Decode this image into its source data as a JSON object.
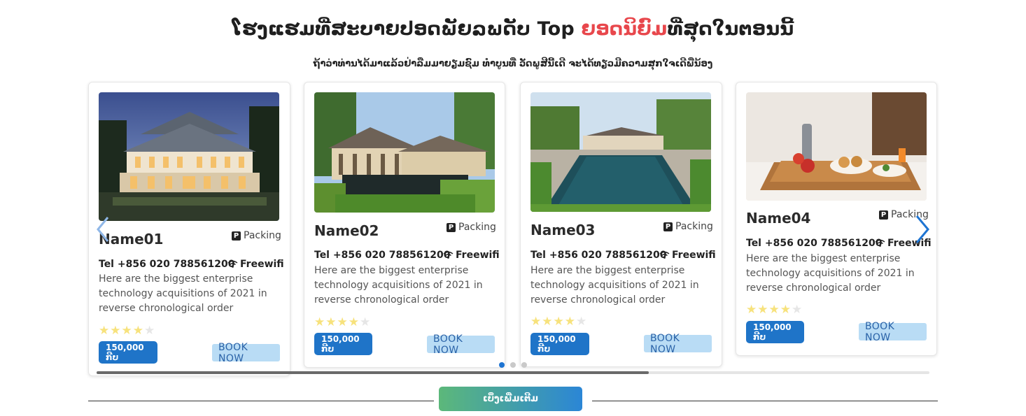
{
  "header": {
    "title_part1": "ໂຮງແຮມທີ່ສະບາຍປອດພັຍລພດັບ Top ",
    "title_accent": "ຍອດນິຍົມ",
    "title_part2": "ທີ່ສຸດໃນຕອນນີ້",
    "subtitle": "ຖ້າວ່າທ່ານໄດ້ມາແລ້ວຢ່າລືມມາຍຽມຊົມ ທຳບູນທີ່ ວັດພູສີນີ້ເດີ ຈະໄດ້ທຽວມີຄວາມສຸກໃຈເດີພີ່ນ້ອງ",
    "accent_color": "#e8474c"
  },
  "cards": [
    {
      "name": "Name01",
      "packing_label": "Packing",
      "tel": "Tel +856 020 788561200",
      "wifi_label": "Freewifi",
      "description": "Here are the biggest enterprise technology acquisitions of 2021 in reverse chronological order",
      "rating": 4,
      "rating_max": 5,
      "price": "150,000 ກີບ",
      "book_label": "BOOK NOW",
      "image": "hotel-night-facade"
    },
    {
      "name": "Name02",
      "packing_label": "Packing",
      "tel": "Tel +856 020 788561200",
      "wifi_label": "Freewifi",
      "description": "Here are the biggest enterprise technology acquisitions of 2021 in reverse chronological order",
      "rating": 4,
      "rating_max": 5,
      "price": "150,000 ກີບ",
      "book_label": "BOOK NOW",
      "image": "hotel-garden-pool"
    },
    {
      "name": "Name03",
      "packing_label": "Packing",
      "tel": "Tel +856 020 788561200",
      "wifi_label": "Freewifi",
      "description": "Here are the biggest enterprise technology acquisitions of 2021 in reverse chronological order",
      "rating": 4,
      "rating_max": 5,
      "price": "150,000 ກີບ",
      "book_label": "BOOK NOW",
      "image": "hotel-long-pool"
    },
    {
      "name": "Name04",
      "packing_label": "Packing",
      "tel": "Tel +856 020 788561200",
      "wifi_label": "Freewifi",
      "description": "Here are the biggest enterprise technology acquisitions of 2021 in reverse chronological order",
      "rating": 4,
      "rating_max": 5,
      "price": "150,000 ກີບ",
      "book_label": "BOOK NOW",
      "image": "breakfast-tray"
    }
  ],
  "carousel": {
    "prev_icon": "chevron-left-icon",
    "next_icon": "chevron-right-icon",
    "page_count": 3,
    "active_page": 1,
    "scroll_progress": 0.66
  },
  "footer": {
    "more_label": "ເບິ່ງເພີ່ມເຕີມ"
  },
  "colors": {
    "primary": "#1f74c8",
    "book_bg": "#b9dcf5",
    "star": "#f7e27c"
  }
}
